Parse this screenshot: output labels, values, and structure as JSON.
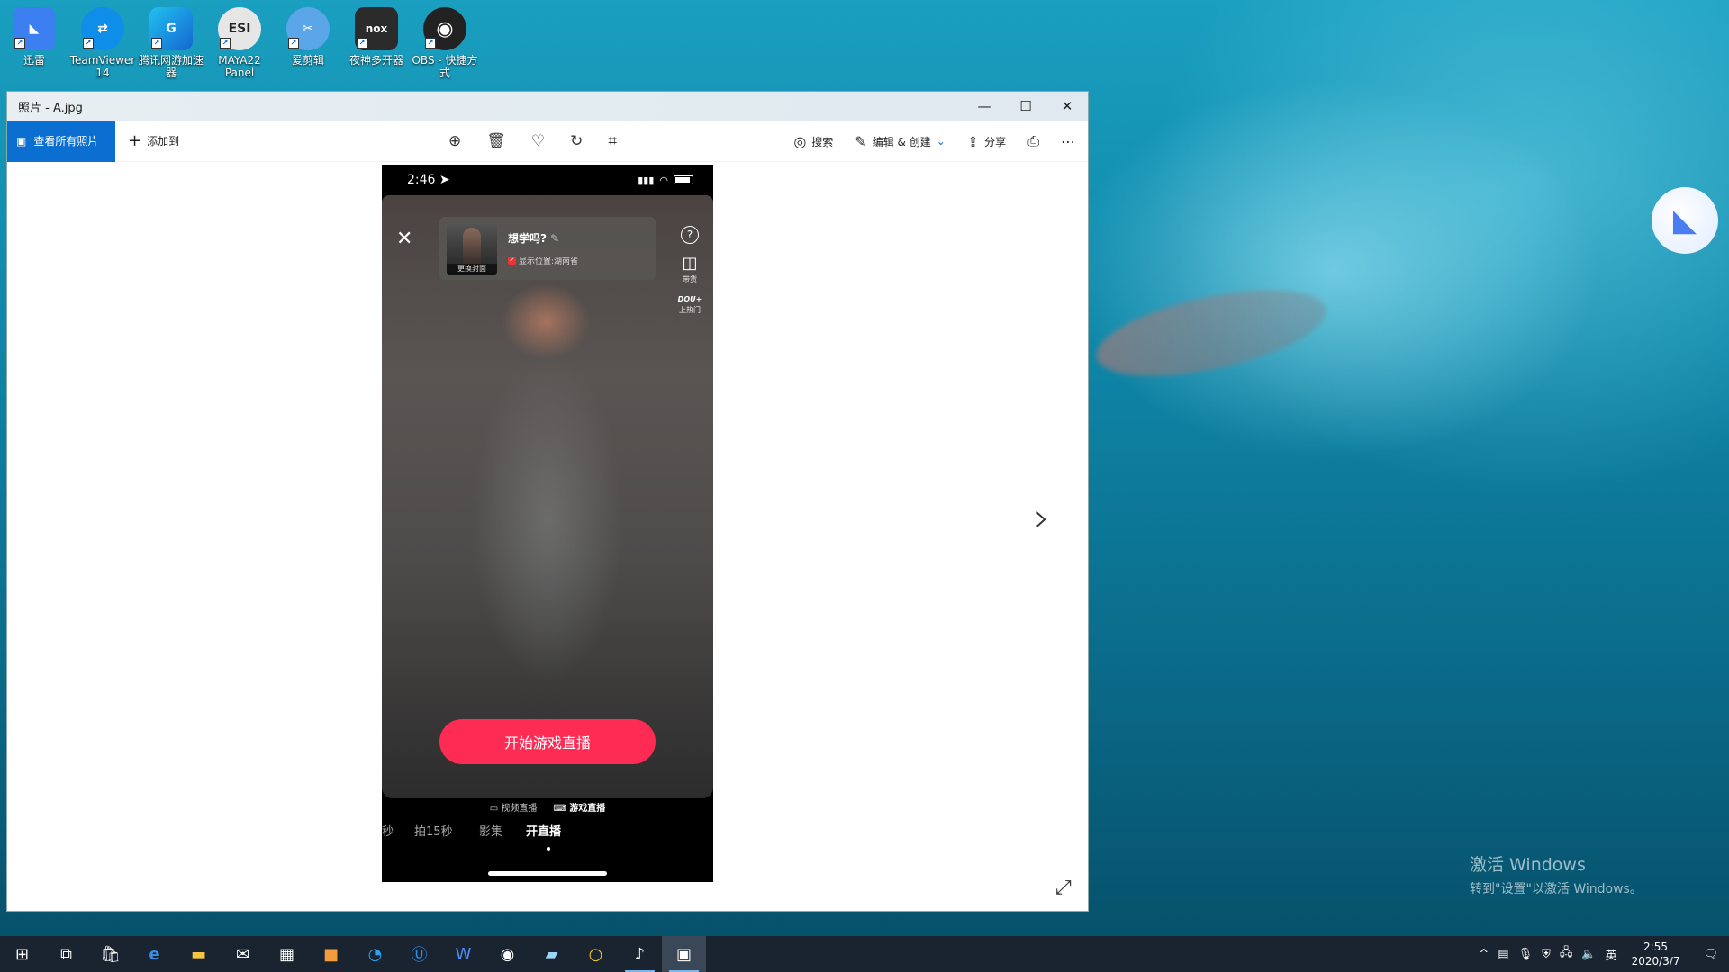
{
  "desktop": {
    "icons": [
      {
        "label": "迅雷",
        "icon": "xunlei-icon",
        "glyph": "◣",
        "color": "#3b7ff0"
      },
      {
        "label": "TeamViewer 14",
        "icon": "teamviewer-icon",
        "glyph": "⇄",
        "color": "#0e8ee9"
      },
      {
        "label": "腾讯网游加速器",
        "icon": "tencent-accelerator-icon",
        "glyph": "G",
        "color": "#1aa4e8"
      },
      {
        "label": "MAYA22 Panel",
        "icon": "maya22-icon",
        "glyph": "ESI",
        "color": "#e6e6e6"
      },
      {
        "label": "爱剪辑",
        "icon": "aijianji-icon",
        "glyph": "✂",
        "color": "#5aa6e8"
      },
      {
        "label": "夜神多开器",
        "icon": "nox-multi-icon",
        "glyph": "nox",
        "color": "#2b2b2b"
      },
      {
        "label": "OBS - 快捷方式",
        "icon": "obs-icon",
        "glyph": "◉",
        "color": "#222"
      }
    ],
    "activate_line1": "激活 Windows",
    "activate_line2": "转到\"设置\"以激活 Windows。"
  },
  "window": {
    "title": "照片 - A.jpg",
    "minimize": "—",
    "maximize": "☐",
    "close": "✕",
    "toolbar": {
      "view_all": "查看所有照片",
      "add_to": "添加到",
      "search": "搜索",
      "edit_create": "编辑 & 创建",
      "share": "分享"
    }
  },
  "phone": {
    "time": "2:46",
    "card_title": "想学吗?",
    "thumb_caption": "更换封面",
    "location": "显示位置:湖南省",
    "side_goods": "带货",
    "side_dou": "DOU+",
    "side_hot": "上热门",
    "start_button": "开始游戏直播",
    "mode_video": "视频直播",
    "mode_game": "游戏直播",
    "tabs": [
      "秒",
      "拍15秒",
      "影集",
      "开直播"
    ],
    "active_tab": "开直播"
  },
  "taskbar": {
    "time": "2:55",
    "date": "2020/3/7",
    "ime": "英"
  }
}
